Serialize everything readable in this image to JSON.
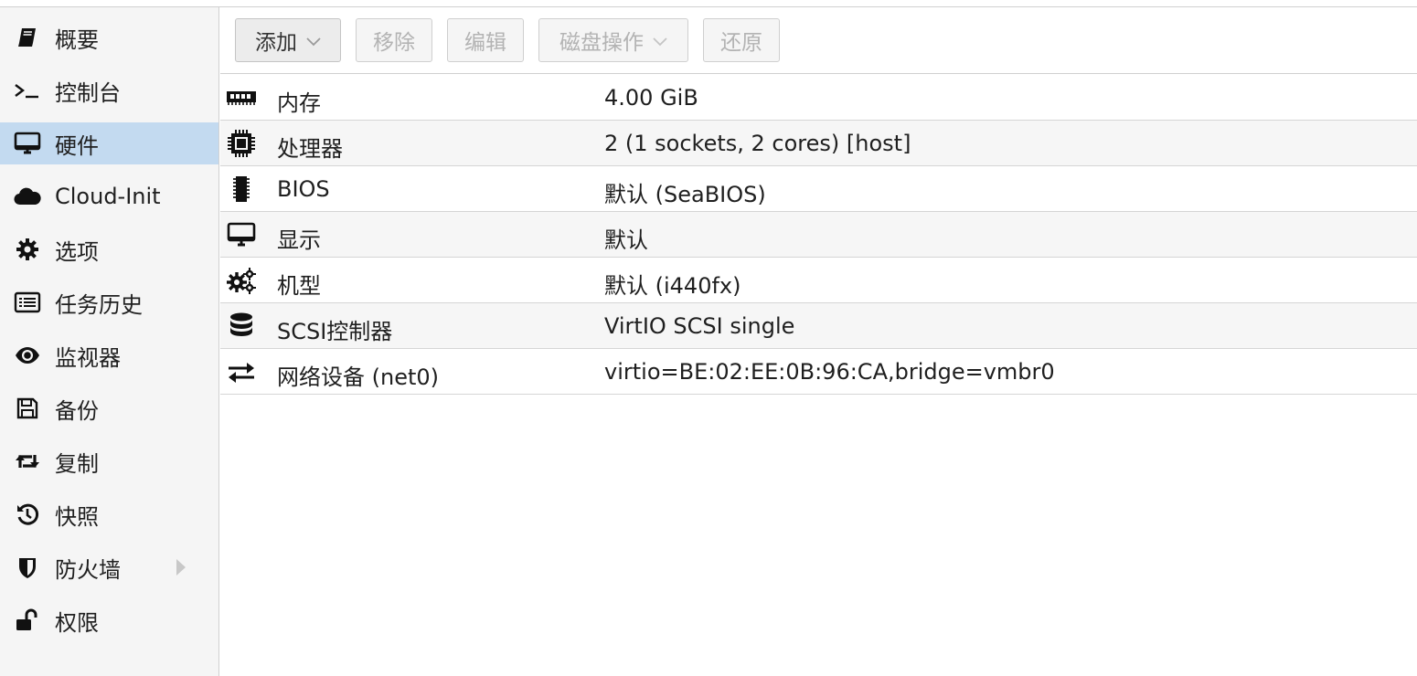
{
  "sidebar": {
    "items": [
      {
        "label": "概要",
        "icon": "book-icon",
        "active": false
      },
      {
        "label": "控制台",
        "icon": "terminal-icon",
        "active": false
      },
      {
        "label": "硬件",
        "icon": "desktop-icon",
        "active": true
      },
      {
        "label": "Cloud-Init",
        "icon": "cloud-icon",
        "active": false
      },
      {
        "label": "选项",
        "icon": "gear-icon",
        "active": false
      },
      {
        "label": "任务历史",
        "icon": "list-icon",
        "active": false
      },
      {
        "label": "监视器",
        "icon": "eye-icon",
        "active": false
      },
      {
        "label": "备份",
        "icon": "floppy-icon",
        "active": false
      },
      {
        "label": "复制",
        "icon": "retweet-icon",
        "active": false
      },
      {
        "label": "快照",
        "icon": "history-icon",
        "active": false
      },
      {
        "label": "防火墙",
        "icon": "shield-icon",
        "active": false,
        "has_submenu": true
      },
      {
        "label": "权限",
        "icon": "unlock-icon",
        "active": false
      }
    ]
  },
  "toolbar": {
    "add_label": "添加",
    "remove_label": "移除",
    "edit_label": "编辑",
    "disk_action_label": "磁盘操作",
    "revert_label": "还原"
  },
  "hardware": {
    "rows": [
      {
        "icon": "memory-icon",
        "name": "内存",
        "value": "4.00 GiB"
      },
      {
        "icon": "cpu-icon",
        "name": "处理器",
        "value": "2 (1 sockets, 2 cores) [host]"
      },
      {
        "icon": "chip-icon",
        "name": "BIOS",
        "value": "默认 (SeaBIOS)"
      },
      {
        "icon": "desktop-icon",
        "name": "显示",
        "value": "默认"
      },
      {
        "icon": "cogs-icon",
        "name": "机型",
        "value": "默认 (i440fx)"
      },
      {
        "icon": "database-icon",
        "name": "SCSI控制器",
        "value": "VirtIO SCSI single"
      },
      {
        "icon": "exchange-icon",
        "name": "网络设备 (net0)",
        "value": "virtio=BE:02:EE:0B:96:CA,bridge=vmbr0"
      }
    ]
  },
  "colors": {
    "active_bg": "#c3daf0",
    "sidebar_bg": "#f5f5f5",
    "border": "#d0d0d0",
    "disabled_text": "#b3b3b3"
  }
}
